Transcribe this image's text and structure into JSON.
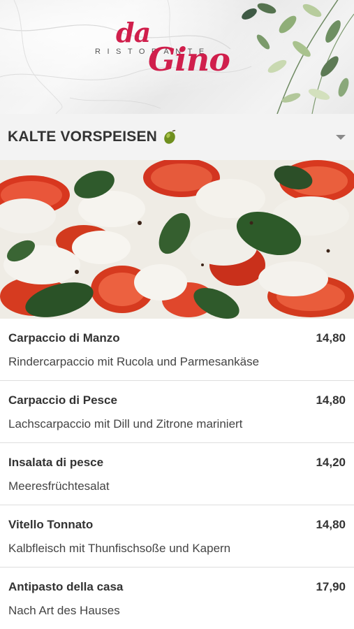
{
  "header": {
    "logo": {
      "da": "da",
      "ristorante": "RISTORANTE",
      "gino": "Gino"
    }
  },
  "section": {
    "title": "KALTE VORSPEISEN",
    "icon": "olive-icon",
    "toggle_icon": "chevron-down-icon"
  },
  "hero": {
    "icon": "caprese-salad-image"
  },
  "colors": {
    "brand": "#d01f4c",
    "text": "#333333",
    "divider": "#dedede",
    "section_bg": "#f3f3f3"
  },
  "menu": {
    "items": [
      {
        "name": "Carpaccio di Manzo",
        "price": "14,80",
        "description": "Rindercarpaccio mit Rucola und Parmesankäse"
      },
      {
        "name": "Carpaccio di Pesce",
        "price": "14,80",
        "description": "Lachscarpaccio mit Dill und Zitrone mariniert"
      },
      {
        "name": "Insalata di pesce",
        "price": "14,20",
        "description": "Meeresfrüchtesalat"
      },
      {
        "name": "Vitello Tonnato",
        "price": "14,80",
        "description": "Kalbfleisch mit Thunfischsoße und Kapern"
      },
      {
        "name": "Antipasto della casa",
        "price": "17,90",
        "description": "Nach Art des Hauses"
      }
    ]
  }
}
